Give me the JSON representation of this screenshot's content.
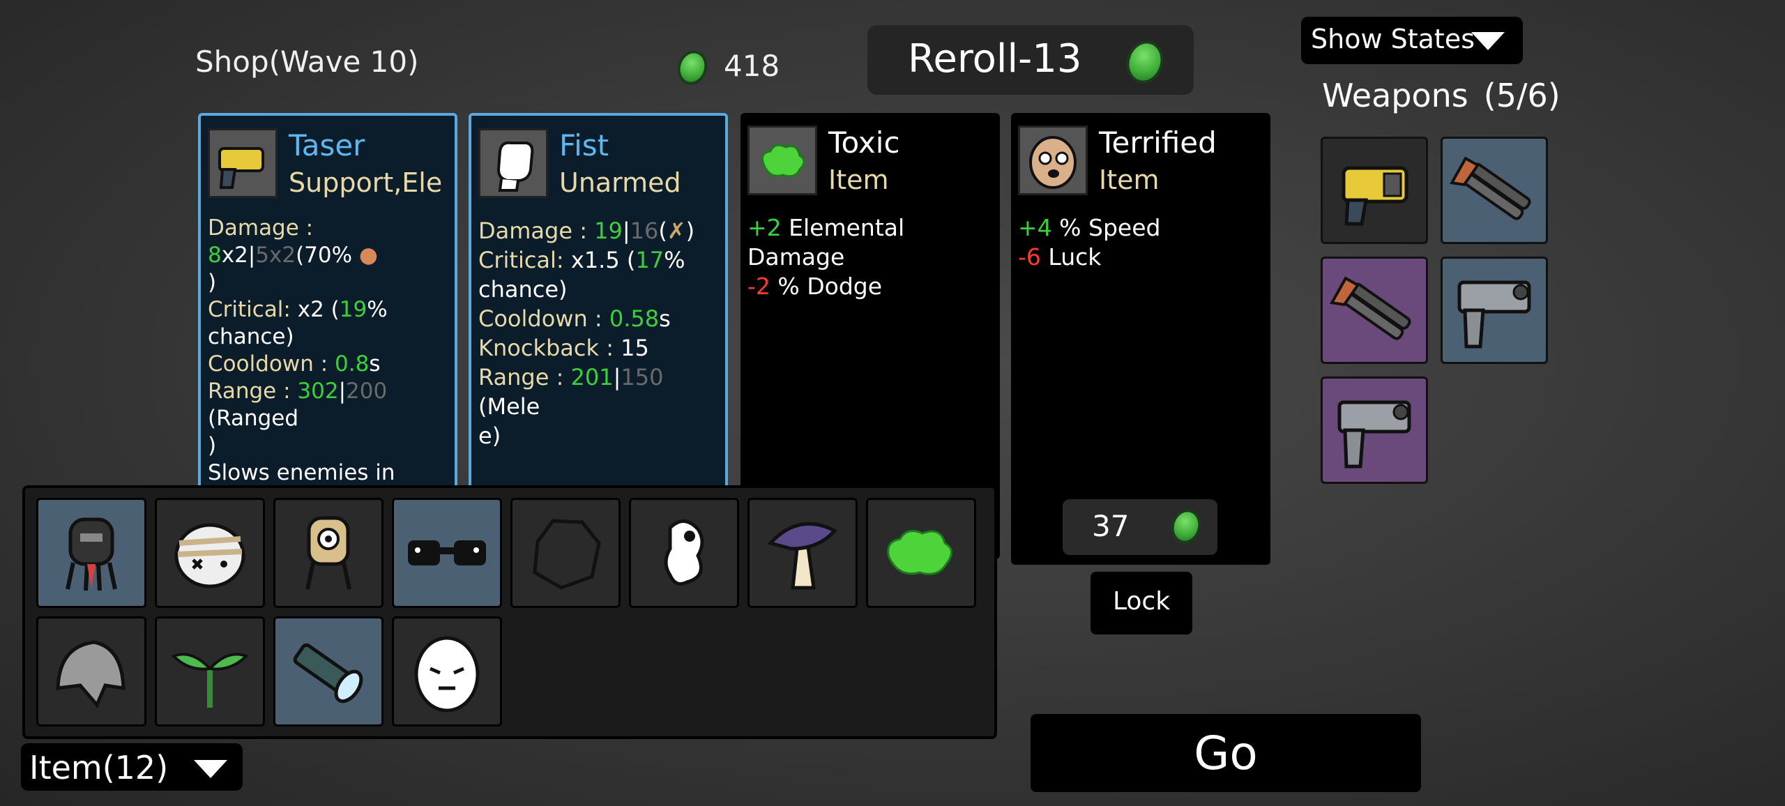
{
  "shop": {
    "title": "Shop(Wave 10)",
    "coins": "418"
  },
  "reroll": {
    "label": "Reroll-13"
  },
  "show_states": {
    "label": "Show States"
  },
  "weapons": {
    "title": "Weapons",
    "count": "(5/6)"
  },
  "cards": [
    {
      "name": "Taser",
      "sub": "Support,Ele",
      "damage": {
        "label": "Damage : ",
        "v": "8",
        "mult": "x2",
        "sep": "|",
        "base": "5x2",
        "extra": "(70%",
        "close": ")"
      },
      "critical": {
        "label": "Critical: ",
        "a": "x2 (",
        "v": "19",
        "b": "% chance)"
      },
      "cooldown": {
        "label": "Cooldown : ",
        "v": "0.8",
        "unit": "s"
      },
      "range": {
        "label": "Range : ",
        "v": "302",
        "sep": "|",
        "base": "200",
        "extra": " (Ranged",
        "close": ")"
      },
      "desc": "Slows enemies in a radius around the projectile"
    },
    {
      "name": "Fist",
      "sub": "Unarmed",
      "damage": {
        "label": "Damage : ",
        "v": "19",
        "sep": "|",
        "base": "16",
        "extra": "(",
        "close": ")"
      },
      "critical": {
        "label": "Critical: ",
        "a": "x1.5 (",
        "v": "17",
        "b": "% chance)"
      },
      "cooldown": {
        "label": "Cooldown : ",
        "v": "0.58",
        "unit": "s"
      },
      "knockback": {
        "label": "Knockback : ",
        "v": "15"
      },
      "range": {
        "label": "Range : ",
        "v": "201",
        "sep": "|",
        "base": "150",
        "extra": " (Mele",
        "close": "e)"
      }
    },
    {
      "name": "Toxic",
      "sub": "Item",
      "lines": [
        {
          "v": "+2",
          "t": " Elemental Damage",
          "c": "g"
        },
        {
          "v": "-2",
          "t": " % Dodge",
          "c": "r"
        }
      ]
    },
    {
      "name": "Terrified",
      "sub": "Item",
      "lines": [
        {
          "v": "+4",
          "t": " % Speed",
          "c": "g"
        },
        {
          "v": "-6",
          "t": " Luck",
          "c": "r"
        }
      ],
      "price": "37",
      "lock": "Lock"
    }
  ],
  "inventory": {
    "tab_label": "Item(12)"
  },
  "go": {
    "label": "Go"
  }
}
